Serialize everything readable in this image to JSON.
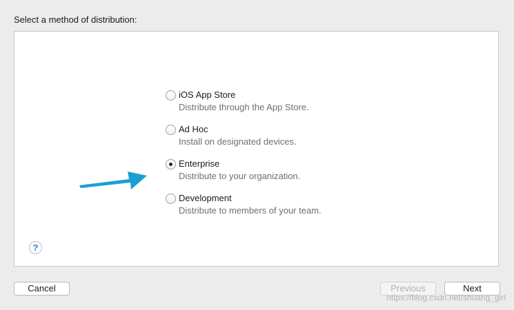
{
  "header": {
    "title": "Select a method of distribution:"
  },
  "options": [
    {
      "label": "iOS App Store",
      "description": "Distribute through the App Store.",
      "selected": false
    },
    {
      "label": "Ad Hoc",
      "description": "Install on designated devices.",
      "selected": false
    },
    {
      "label": "Enterprise",
      "description": "Distribute to your organization.",
      "selected": true
    },
    {
      "label": "Development",
      "description": "Distribute to members of your team.",
      "selected": false
    }
  ],
  "help": {
    "glyph": "?"
  },
  "buttons": {
    "cancel": "Cancel",
    "previous": "Previous",
    "next": "Next"
  },
  "watermark": "https://blog.csdn.net/shuang_girl",
  "colors": {
    "arrow": "#1a9fd4",
    "help_glyph": "#2c7be5"
  }
}
